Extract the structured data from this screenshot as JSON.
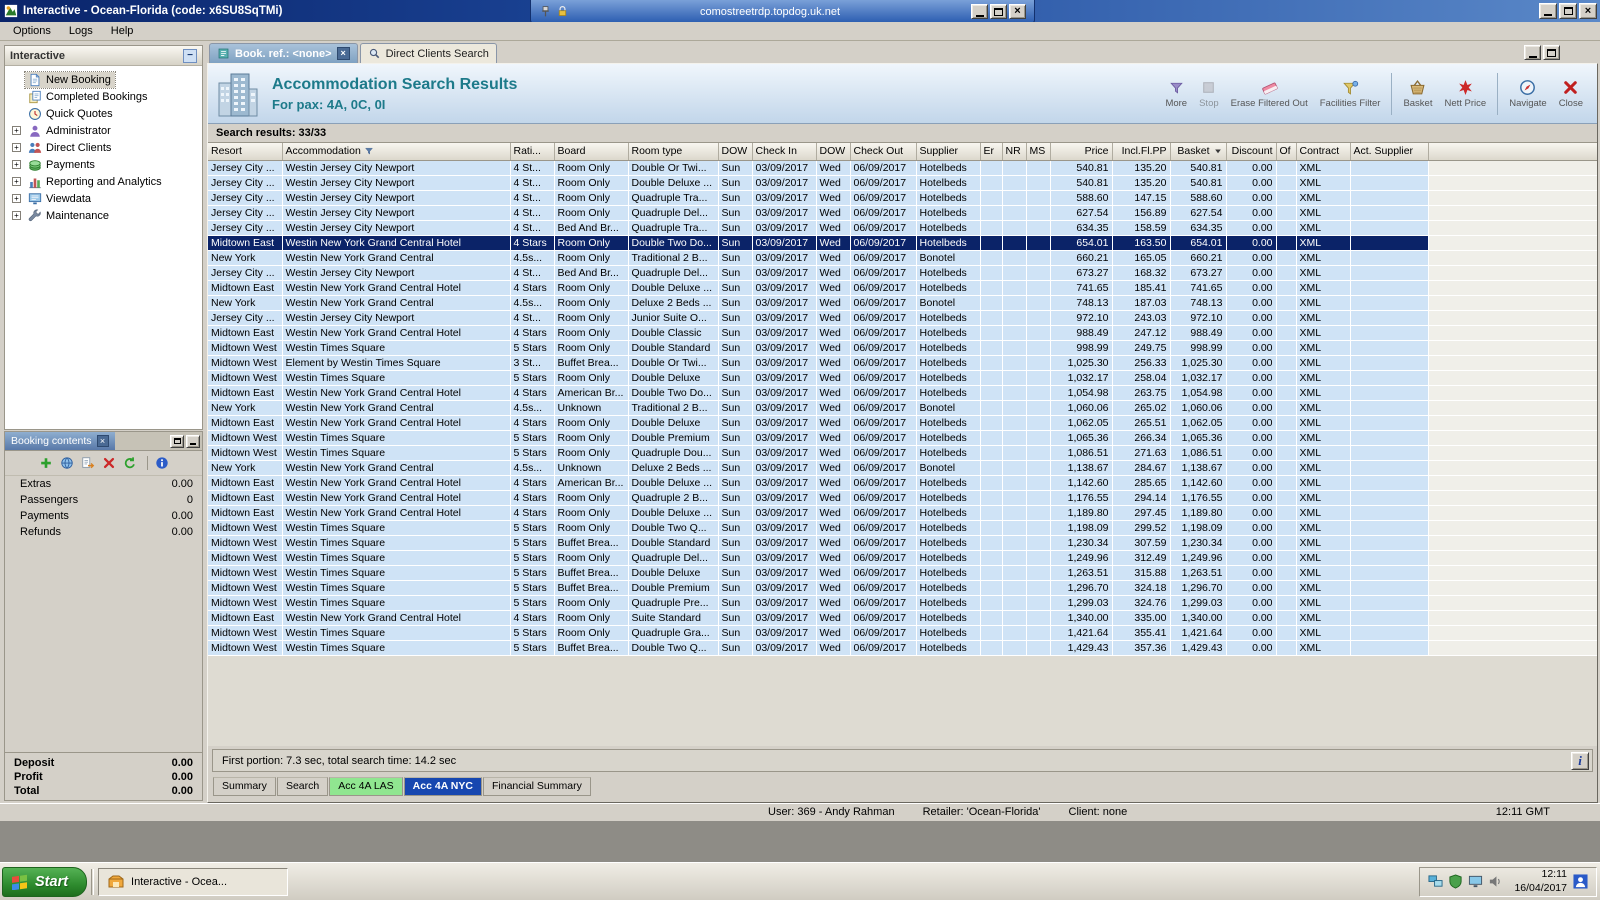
{
  "window": {
    "title": "Interactive - Ocean-Florida (code: x6SU8SqTMi)"
  },
  "rdp": {
    "host": "comostreetrdp.topdog.uk.net"
  },
  "menu": {
    "items": [
      "Options",
      "Logs",
      "Help"
    ]
  },
  "sidebar": {
    "title": "Interactive",
    "items": [
      {
        "label": "New Booking",
        "icon": "new-booking-icon",
        "selected": true,
        "expandable": false
      },
      {
        "label": "Completed Bookings",
        "icon": "completed-bookings-icon",
        "expandable": false
      },
      {
        "label": "Quick Quotes",
        "icon": "quick-quotes-icon",
        "expandable": false
      },
      {
        "label": "Administrator",
        "icon": "administrator-icon",
        "expandable": true
      },
      {
        "label": "Direct Clients",
        "icon": "direct-clients-icon",
        "expandable": true
      },
      {
        "label": "Payments",
        "icon": "payments-icon",
        "expandable": true
      },
      {
        "label": "Reporting and Analytics",
        "icon": "reporting-icon",
        "expandable": true
      },
      {
        "label": "Viewdata",
        "icon": "viewdata-icon",
        "expandable": true
      },
      {
        "label": "Maintenance",
        "icon": "maintenance-icon",
        "expandable": true
      }
    ]
  },
  "booking_contents": {
    "title": "Booking contents",
    "toolbar": [
      {
        "name": "add-button",
        "icon": "add-icon"
      },
      {
        "name": "web-button",
        "icon": "globe-icon"
      },
      {
        "name": "export-button",
        "icon": "export-icon"
      },
      {
        "name": "delete-button",
        "icon": "delete-icon"
      },
      {
        "name": "refresh-button",
        "icon": "refresh-icon"
      },
      {
        "name": "info-button",
        "icon": "info-icon",
        "sep": true
      }
    ],
    "rows": [
      {
        "label": "Extras",
        "value": "0.00"
      },
      {
        "label": "Passengers",
        "value": "0"
      },
      {
        "label": "Payments",
        "value": "0.00"
      },
      {
        "label": "Refunds",
        "value": "0.00"
      }
    ],
    "totals": [
      {
        "label": "Deposit",
        "value": "0.00"
      },
      {
        "label": "Profit",
        "value": "0.00"
      },
      {
        "label": "Total",
        "value": "0.00"
      }
    ]
  },
  "tabs": [
    {
      "label": "Book. ref.: <none>",
      "icon": "book-tab-icon",
      "active": true,
      "closable": true
    },
    {
      "label": "Direct Clients Search",
      "icon": "magnifier-icon",
      "active": false
    }
  ],
  "header": {
    "title": "Accommodation Search Results",
    "subtitle": "For pax: 4A, 0C, 0I",
    "tools": [
      {
        "label": "More",
        "icon": "more-icon"
      },
      {
        "label": "Stop",
        "icon": "stop-icon",
        "disabled": true
      },
      {
        "label": "Erase Filtered Out",
        "icon": "erase-icon"
      },
      {
        "label": "Facilities Filter",
        "icon": "facilities-icon"
      },
      {
        "label": "Basket",
        "icon": "basket-icon",
        "sep": true
      },
      {
        "label": "Nett Price",
        "icon": "nett-price-icon"
      },
      {
        "label": "Navigate",
        "icon": "navigate-icon",
        "sep": true
      },
      {
        "label": "Close",
        "icon": "close-red-icon"
      }
    ]
  },
  "results": {
    "summary": "Search results: 33/33",
    "selected_index": 5,
    "columns": [
      {
        "label": "Resort"
      },
      {
        "label": "Accommodation",
        "icon": "filter-small-icon"
      },
      {
        "label": "Rati..."
      },
      {
        "label": "Board"
      },
      {
        "label": "Room type"
      },
      {
        "label": "DOW"
      },
      {
        "label": "Check In"
      },
      {
        "label": "DOW"
      },
      {
        "label": "Check Out"
      },
      {
        "label": "Supplier"
      },
      {
        "label": "Er"
      },
      {
        "label": "NR"
      },
      {
        "label": "MS"
      },
      {
        "label": "Price",
        "align": "right"
      },
      {
        "label": "Incl.Fl.PP",
        "align": "right"
      },
      {
        "label": "Basket",
        "icon": "sort-icon",
        "align": "right"
      },
      {
        "label": "Discount",
        "align": "right"
      },
      {
        "label": "Of"
      },
      {
        "label": "Contract"
      },
      {
        "label": "Act. Supplier"
      }
    ],
    "rows": [
      [
        "Jersey City ...",
        "Westin Jersey City Newport",
        "4 St...",
        "Room Only",
        "Double Or Twi...",
        "Sun",
        "03/09/2017",
        "Wed",
        "06/09/2017",
        "Hotelbeds",
        "",
        "",
        "",
        "540.81",
        "135.20",
        "540.81",
        "0.00",
        "",
        "XML",
        ""
      ],
      [
        "Jersey City ...",
        "Westin Jersey City Newport",
        "4 St...",
        "Room Only",
        "Double Deluxe ...",
        "Sun",
        "03/09/2017",
        "Wed",
        "06/09/2017",
        "Hotelbeds",
        "",
        "",
        "",
        "540.81",
        "135.20",
        "540.81",
        "0.00",
        "",
        "XML",
        ""
      ],
      [
        "Jersey City ...",
        "Westin Jersey City Newport",
        "4 St...",
        "Room Only",
        "Quadruple Tra...",
        "Sun",
        "03/09/2017",
        "Wed",
        "06/09/2017",
        "Hotelbeds",
        "",
        "",
        "",
        "588.60",
        "147.15",
        "588.60",
        "0.00",
        "",
        "XML",
        ""
      ],
      [
        "Jersey City ...",
        "Westin Jersey City Newport",
        "4 St...",
        "Room Only",
        "Quadruple Del...",
        "Sun",
        "03/09/2017",
        "Wed",
        "06/09/2017",
        "Hotelbeds",
        "",
        "",
        "",
        "627.54",
        "156.89",
        "627.54",
        "0.00",
        "",
        "XML",
        ""
      ],
      [
        "Jersey City ...",
        "Westin Jersey City Newport",
        "4 St...",
        "Bed And Br...",
        "Quadruple Tra...",
        "Sun",
        "03/09/2017",
        "Wed",
        "06/09/2017",
        "Hotelbeds",
        "",
        "",
        "",
        "634.35",
        "158.59",
        "634.35",
        "0.00",
        "",
        "XML",
        ""
      ],
      [
        "Midtown East",
        "Westin New York Grand Central Hotel",
        "4 Stars",
        "Room Only",
        "Double Two Do...",
        "Sun",
        "03/09/2017",
        "Wed",
        "06/09/2017",
        "Hotelbeds",
        "",
        "",
        "",
        "654.01",
        "163.50",
        "654.01",
        "0.00",
        "",
        "XML",
        ""
      ],
      [
        "New York",
        "Westin New York Grand Central",
        "4.5s...",
        "Room Only",
        "Traditional 2 B...",
        "Sun",
        "03/09/2017",
        "Wed",
        "06/09/2017",
        "Bonotel",
        "",
        "",
        "",
        "660.21",
        "165.05",
        "660.21",
        "0.00",
        "",
        "XML",
        ""
      ],
      [
        "Jersey City ...",
        "Westin Jersey City Newport",
        "4 St...",
        "Bed And Br...",
        "Quadruple Del...",
        "Sun",
        "03/09/2017",
        "Wed",
        "06/09/2017",
        "Hotelbeds",
        "",
        "",
        "",
        "673.27",
        "168.32",
        "673.27",
        "0.00",
        "",
        "XML",
        ""
      ],
      [
        "Midtown East",
        "Westin New York Grand Central Hotel",
        "4 Stars",
        "Room Only",
        "Double Deluxe ...",
        "Sun",
        "03/09/2017",
        "Wed",
        "06/09/2017",
        "Hotelbeds",
        "",
        "",
        "",
        "741.65",
        "185.41",
        "741.65",
        "0.00",
        "",
        "XML",
        ""
      ],
      [
        "New York",
        "Westin New York Grand Central",
        "4.5s...",
        "Room Only",
        "Deluxe 2 Beds ...",
        "Sun",
        "03/09/2017",
        "Wed",
        "06/09/2017",
        "Bonotel",
        "",
        "",
        "",
        "748.13",
        "187.03",
        "748.13",
        "0.00",
        "",
        "XML",
        ""
      ],
      [
        "Jersey City ...",
        "Westin Jersey City Newport",
        "4 St...",
        "Room Only",
        "Junior Suite O...",
        "Sun",
        "03/09/2017",
        "Wed",
        "06/09/2017",
        "Hotelbeds",
        "",
        "",
        "",
        "972.10",
        "243.03",
        "972.10",
        "0.00",
        "",
        "XML",
        ""
      ],
      [
        "Midtown East",
        "Westin New York Grand Central Hotel",
        "4 Stars",
        "Room Only",
        "Double Classic",
        "Sun",
        "03/09/2017",
        "Wed",
        "06/09/2017",
        "Hotelbeds",
        "",
        "",
        "",
        "988.49",
        "247.12",
        "988.49",
        "0.00",
        "",
        "XML",
        ""
      ],
      [
        "Midtown West",
        "Westin Times Square",
        "5 Stars",
        "Room Only",
        "Double Standard",
        "Sun",
        "03/09/2017",
        "Wed",
        "06/09/2017",
        "Hotelbeds",
        "",
        "",
        "",
        "998.99",
        "249.75",
        "998.99",
        "0.00",
        "",
        "XML",
        ""
      ],
      [
        "Midtown West",
        "Element by Westin Times Square",
        "3 St...",
        "Buffet Brea...",
        "Double Or Twi...",
        "Sun",
        "03/09/2017",
        "Wed",
        "06/09/2017",
        "Hotelbeds",
        "",
        "",
        "",
        "1,025.30",
        "256.33",
        "1,025.30",
        "0.00",
        "",
        "XML",
        ""
      ],
      [
        "Midtown West",
        "Westin Times Square",
        "5 Stars",
        "Room Only",
        "Double Deluxe",
        "Sun",
        "03/09/2017",
        "Wed",
        "06/09/2017",
        "Hotelbeds",
        "",
        "",
        "",
        "1,032.17",
        "258.04",
        "1,032.17",
        "0.00",
        "",
        "XML",
        ""
      ],
      [
        "Midtown East",
        "Westin New York Grand Central Hotel",
        "4 Stars",
        "American Br...",
        "Double Two Do...",
        "Sun",
        "03/09/2017",
        "Wed",
        "06/09/2017",
        "Hotelbeds",
        "",
        "",
        "",
        "1,054.98",
        "263.75",
        "1,054.98",
        "0.00",
        "",
        "XML",
        ""
      ],
      [
        "New York",
        "Westin New York Grand Central",
        "4.5s...",
        "Unknown",
        "Traditional 2 B...",
        "Sun",
        "03/09/2017",
        "Wed",
        "06/09/2017",
        "Bonotel",
        "",
        "",
        "",
        "1,060.06",
        "265.02",
        "1,060.06",
        "0.00",
        "",
        "XML",
        ""
      ],
      [
        "Midtown East",
        "Westin New York Grand Central Hotel",
        "4 Stars",
        "Room Only",
        "Double Deluxe",
        "Sun",
        "03/09/2017",
        "Wed",
        "06/09/2017",
        "Hotelbeds",
        "",
        "",
        "",
        "1,062.05",
        "265.51",
        "1,062.05",
        "0.00",
        "",
        "XML",
        ""
      ],
      [
        "Midtown West",
        "Westin Times Square",
        "5 Stars",
        "Room Only",
        "Double Premium",
        "Sun",
        "03/09/2017",
        "Wed",
        "06/09/2017",
        "Hotelbeds",
        "",
        "",
        "",
        "1,065.36",
        "266.34",
        "1,065.36",
        "0.00",
        "",
        "XML",
        ""
      ],
      [
        "Midtown West",
        "Westin Times Square",
        "5 Stars",
        "Room Only",
        "Quadruple Dou...",
        "Sun",
        "03/09/2017",
        "Wed",
        "06/09/2017",
        "Hotelbeds",
        "",
        "",
        "",
        "1,086.51",
        "271.63",
        "1,086.51",
        "0.00",
        "",
        "XML",
        ""
      ],
      [
        "New York",
        "Westin New York Grand Central",
        "4.5s...",
        "Unknown",
        "Deluxe 2 Beds ...",
        "Sun",
        "03/09/2017",
        "Wed",
        "06/09/2017",
        "Bonotel",
        "",
        "",
        "",
        "1,138.67",
        "284.67",
        "1,138.67",
        "0.00",
        "",
        "XML",
        ""
      ],
      [
        "Midtown East",
        "Westin New York Grand Central Hotel",
        "4 Stars",
        "American Br...",
        "Double Deluxe ...",
        "Sun",
        "03/09/2017",
        "Wed",
        "06/09/2017",
        "Hotelbeds",
        "",
        "",
        "",
        "1,142.60",
        "285.65",
        "1,142.60",
        "0.00",
        "",
        "XML",
        ""
      ],
      [
        "Midtown East",
        "Westin New York Grand Central Hotel",
        "4 Stars",
        "Room Only",
        "Quadruple 2 B...",
        "Sun",
        "03/09/2017",
        "Wed",
        "06/09/2017",
        "Hotelbeds",
        "",
        "",
        "",
        "1,176.55",
        "294.14",
        "1,176.55",
        "0.00",
        "",
        "XML",
        ""
      ],
      [
        "Midtown East",
        "Westin New York Grand Central Hotel",
        "4 Stars",
        "Room Only",
        "Double Deluxe ...",
        "Sun",
        "03/09/2017",
        "Wed",
        "06/09/2017",
        "Hotelbeds",
        "",
        "",
        "",
        "1,189.80",
        "297.45",
        "1,189.80",
        "0.00",
        "",
        "XML",
        ""
      ],
      [
        "Midtown West",
        "Westin Times Square",
        "5 Stars",
        "Room Only",
        "Double Two Q...",
        "Sun",
        "03/09/2017",
        "Wed",
        "06/09/2017",
        "Hotelbeds",
        "",
        "",
        "",
        "1,198.09",
        "299.52",
        "1,198.09",
        "0.00",
        "",
        "XML",
        ""
      ],
      [
        "Midtown West",
        "Westin Times Square",
        "5 Stars",
        "Buffet Brea...",
        "Double Standard",
        "Sun",
        "03/09/2017",
        "Wed",
        "06/09/2017",
        "Hotelbeds",
        "",
        "",
        "",
        "1,230.34",
        "307.59",
        "1,230.34",
        "0.00",
        "",
        "XML",
        ""
      ],
      [
        "Midtown West",
        "Westin Times Square",
        "5 Stars",
        "Room Only",
        "Quadruple Del...",
        "Sun",
        "03/09/2017",
        "Wed",
        "06/09/2017",
        "Hotelbeds",
        "",
        "",
        "",
        "1,249.96",
        "312.49",
        "1,249.96",
        "0.00",
        "",
        "XML",
        ""
      ],
      [
        "Midtown West",
        "Westin Times Square",
        "5 Stars",
        "Buffet Brea...",
        "Double Deluxe",
        "Sun",
        "03/09/2017",
        "Wed",
        "06/09/2017",
        "Hotelbeds",
        "",
        "",
        "",
        "1,263.51",
        "315.88",
        "1,263.51",
        "0.00",
        "",
        "XML",
        ""
      ],
      [
        "Midtown West",
        "Westin Times Square",
        "5 Stars",
        "Buffet Brea...",
        "Double Premium",
        "Sun",
        "03/09/2017",
        "Wed",
        "06/09/2017",
        "Hotelbeds",
        "",
        "",
        "",
        "1,296.70",
        "324.18",
        "1,296.70",
        "0.00",
        "",
        "XML",
        ""
      ],
      [
        "Midtown West",
        "Westin Times Square",
        "5 Stars",
        "Room Only",
        "Quadruple Pre...",
        "Sun",
        "03/09/2017",
        "Wed",
        "06/09/2017",
        "Hotelbeds",
        "",
        "",
        "",
        "1,299.03",
        "324.76",
        "1,299.03",
        "0.00",
        "",
        "XML",
        ""
      ],
      [
        "Midtown East",
        "Westin New York Grand Central Hotel",
        "4 Stars",
        "Room Only",
        "Suite Standard",
        "Sun",
        "03/09/2017",
        "Wed",
        "06/09/2017",
        "Hotelbeds",
        "",
        "",
        "",
        "1,340.00",
        "335.00",
        "1,340.00",
        "0.00",
        "",
        "XML",
        ""
      ],
      [
        "Midtown West",
        "Westin Times Square",
        "5 Stars",
        "Room Only",
        "Quadruple Gra...",
        "Sun",
        "03/09/2017",
        "Wed",
        "06/09/2017",
        "Hotelbeds",
        "",
        "",
        "",
        "1,421.64",
        "355.41",
        "1,421.64",
        "0.00",
        "",
        "XML",
        ""
      ],
      [
        "Midtown West",
        "Westin Times Square",
        "5 Stars",
        "Buffet Brea...",
        "Double Two Q...",
        "Sun",
        "03/09/2017",
        "Wed",
        "06/09/2017",
        "Hotelbeds",
        "",
        "",
        "",
        "1,429.43",
        "357.36",
        "1,429.43",
        "0.00",
        "",
        "XML",
        ""
      ]
    ]
  },
  "footer": {
    "timing": "First portion: 7.3 sec, total search time: 14.2 sec",
    "tabs": [
      {
        "label": "Summary"
      },
      {
        "label": "Search"
      },
      {
        "label": "Acc 4A LAS",
        "variant": "green"
      },
      {
        "label": "Acc 4A NYC",
        "variant": "blue",
        "active": true
      },
      {
        "label": "Financial Summary"
      }
    ]
  },
  "statusbar": {
    "items": [
      "User: 369 - Andy Rahman",
      "Retailer: 'Ocean-Florida'",
      "Client: none"
    ],
    "time": "12:11 GMT"
  },
  "taskbar": {
    "start_label": "Start",
    "task_label": "Interactive - Ocea...",
    "tray_icons": [
      "network-icon",
      "antivirus-icon",
      "display-icon",
      "volume-icon"
    ],
    "clock_time": "12:11",
    "clock_date": "16/04/2017"
  }
}
